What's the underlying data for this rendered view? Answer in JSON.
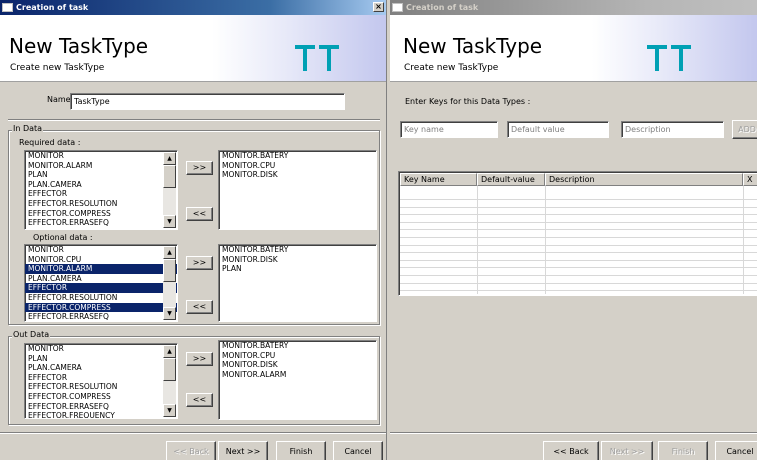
{
  "left_window": {
    "title": "Creation of task",
    "close_glyph": "×",
    "header": {
      "title": "New TaskType",
      "subtitle": "Create new TaskType"
    },
    "name_label": "Name",
    "name_value": "TaskType",
    "in_data": {
      "legend": "In Data",
      "required": {
        "label": "Required data :",
        "available": [
          "MONITOR",
          "MONITOR.ALARM",
          "PLAN",
          "PLAN.CAMERA",
          "EFFECTOR",
          "EFFECTOR.RESOLUTION",
          "EFFECTOR.COMPRESS",
          "EFFECTOR.ERRASEFQ"
        ],
        "selected": [
          "MONITOR.BATERY",
          "MONITOR.CPU",
          "MONITOR.DISK"
        ]
      },
      "optional": {
        "label": "Optional data :",
        "available": [
          "MONITOR",
          "MONITOR.CPU",
          "MONITOR.ALARM",
          "PLAN.CAMERA",
          "EFFECTOR",
          "EFFECTOR.RESOLUTION",
          "EFFECTOR.COMPRESS",
          "EFFECTOR.ERRASEFQ"
        ],
        "highlighted": [
          "MONITOR.ALARM",
          "EFFECTOR",
          "EFFECTOR.COMPRESS"
        ],
        "selected": [
          "MONITOR.BATERY",
          "MONITOR.DISK",
          "PLAN"
        ]
      }
    },
    "out_data": {
      "legend": "Out Data",
      "available": [
        "MONITOR",
        "PLAN",
        "PLAN.CAMERA",
        "EFFECTOR",
        "EFFECTOR.RESOLUTION",
        "EFFECTOR.COMPRESS",
        "EFFECTOR.ERRASEFQ",
        "EFFECTOR.FREQUENCY"
      ],
      "selected": [
        "MONITOR.BATERY",
        "MONITOR.CPU",
        "MONITOR.DISK",
        "MONITOR.ALARM"
      ]
    },
    "add_label": ">>",
    "remove_label": "<<",
    "footer": {
      "back": "<< Back",
      "next": "Next >>",
      "finish": "Finish",
      "cancel": "Cancel"
    }
  },
  "right_window": {
    "title": "Creation of task",
    "header": {
      "title": "New TaskType",
      "subtitle": "Create new TaskType"
    },
    "instruction": "Enter Keys for this Data Types :",
    "key_name_placeholder": "Key name",
    "default_value_placeholder": "Default value",
    "description_placeholder": "Description",
    "add_label": "ADD",
    "table": {
      "columns": [
        "Key Name",
        "Default-value",
        "Description",
        "X"
      ],
      "rows": []
    },
    "footer": {
      "back": "<< Back",
      "next": "Next >>",
      "finish": "Finish",
      "cancel": "Cancel"
    }
  },
  "colors": {
    "title_active": "#0a246a",
    "selection": "#0a246a",
    "logo": "#00a0b4",
    "face": "#d4d0c8"
  }
}
